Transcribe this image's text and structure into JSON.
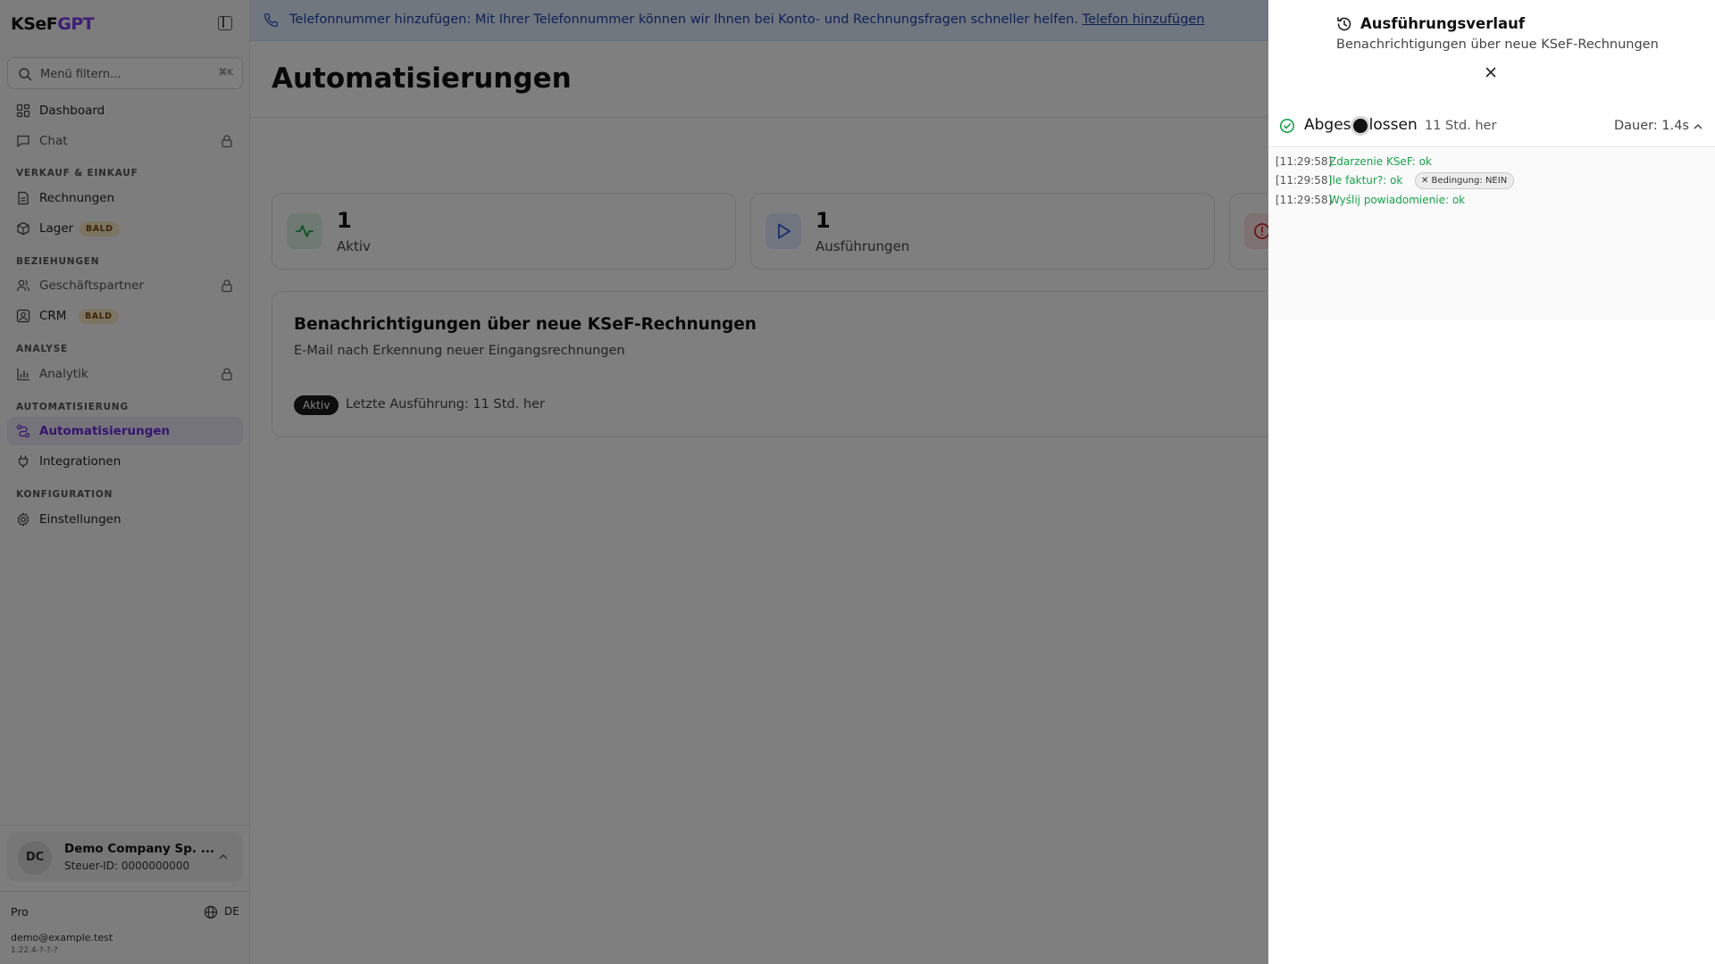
{
  "sidebar": {
    "logo_part1": "KSeF",
    "logo_part2": "GPT",
    "search": {
      "placeholder": "Menü filtern...",
      "shortcut": "⌘K"
    },
    "items": {
      "dashboard": "Dashboard",
      "chat": "Chat",
      "invoices": "Rechnungen",
      "warehouse": "Lager",
      "partners": "Geschäftspartner",
      "crm": "CRM",
      "analytics": "Analytik",
      "automations": "Automatisierungen",
      "integrations": "Integrationen",
      "settings": "Einstellungen"
    },
    "sections": {
      "sales": "VERKAUF & EINKAUF",
      "relations": "BEZIEHUNGEN",
      "analysis": "ANALYSE",
      "automation": "AUTOMATISIERUNG",
      "configuration": "KONFIGURATION"
    },
    "soon_badge": "BALD",
    "company": {
      "initials": "DC",
      "name": "Demo Company Sp. ...",
      "tax_id": "Steuer-ID: 0000000000"
    },
    "plan": "Pro",
    "language": "DE",
    "email": "demo@example.test",
    "version": "1.22.4-?-?-?"
  },
  "banner": {
    "text": "Telefonnummer hinzufügen: Mit Ihrer Telefonnummer können wir Ihnen bei Konto- und Rechnungsfragen schneller helfen.",
    "link": "Telefon hinzufügen"
  },
  "main": {
    "title": "Automatisierungen",
    "stats": [
      {
        "value": "1",
        "label": "Aktiv"
      },
      {
        "value": "1",
        "label": "Ausführungen"
      }
    ],
    "automation": {
      "title": "Benachrichtigungen über neue KSeF-Rechnungen",
      "description": "E-Mail nach Erkennung neuer Eingangsrechnungen",
      "status": "Aktiv",
      "last_run": "Letzte Ausführung: 11 Std. her"
    }
  },
  "panel": {
    "title": "Ausführungsverlauf",
    "subtitle": "Benachrichtigungen über neue KSeF-Rechnungen",
    "run": {
      "status": "Abgeschlossen",
      "time_ago": "11 Std. her",
      "duration": "Dauer: 1.4s"
    },
    "logs": [
      {
        "time": "[11:29:58]",
        "message": "Zdarzenie KSeF: ok"
      },
      {
        "time": "[11:29:58]",
        "message": "Ile faktur?: ok",
        "badge": "✕ Bedingung: NEIN"
      },
      {
        "time": "[11:29:58]",
        "message": "Wyślij powiadomienie: ok"
      }
    ]
  },
  "colors": {
    "accent": "#7c3aed",
    "success": "#17a34a",
    "danger": "#dc2626",
    "banner_bg": "#e3efff"
  },
  "icons": [
    "search-icon",
    "dashboard-icon",
    "chat-icon",
    "lock-icon",
    "invoice-icon",
    "box-icon",
    "users-icon",
    "contact-card-icon",
    "bar-chart-icon",
    "workflow-icon",
    "plug-icon",
    "gear-icon",
    "globe-icon",
    "phone-icon",
    "activity-icon",
    "play-icon",
    "alert-circle-icon",
    "history-icon",
    "close-icon",
    "check-circle-icon",
    "chevron-up-icon"
  ]
}
